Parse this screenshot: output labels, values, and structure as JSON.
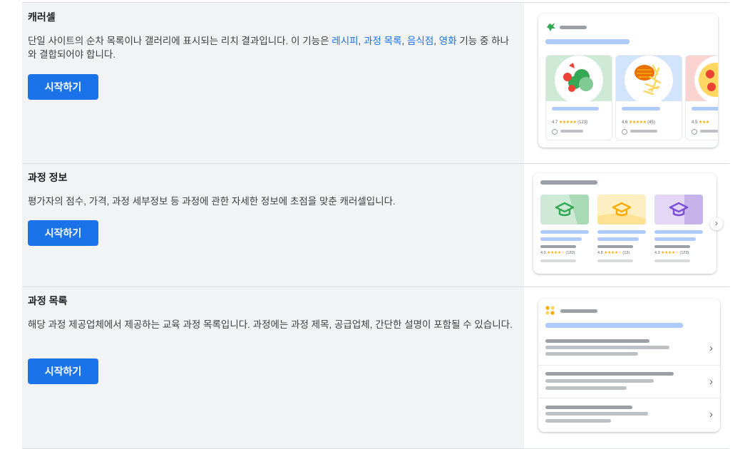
{
  "sections": [
    {
      "title": "캐러셀",
      "desc_before": "단일 사이트의 순차 목록이나 갤러리에 표시되는 리치 결과입니다. 이 기능은 ",
      "links": [
        "레시피",
        "과정 목록",
        "음식점",
        "영화"
      ],
      "sep": ", ",
      "desc_after": " 기능 중 하나와 결합되어야 합니다.",
      "button": "시작하기",
      "preview": {
        "cards": [
          {
            "rating": "4.7",
            "stars": "★★★★★",
            "count": "(123)"
          },
          {
            "rating": "4.6",
            "stars": "★★★★★",
            "count": "(45)"
          },
          {
            "rating": "4.5",
            "stars": "★★★"
          }
        ]
      }
    },
    {
      "title": "과정 정보",
      "desc": "평가자의 점수, 가격, 과정 세부정보 등 과정에 관한 자세한 정보에 초점을 맞춘 캐러셀입니다.",
      "button": "시작하기",
      "preview": {
        "cards": [
          {
            "rating": "4.0",
            "stars": "★★★★☆",
            "count": "(120)",
            "color": "#34a853",
            "bg": "#ceead6"
          },
          {
            "rating": "4.8",
            "stars": "★★★★☆",
            "count": "(13)",
            "color": "#f9ab00",
            "bg": "#feefc3"
          },
          {
            "rating": "4.3",
            "stars": "★★★★☆",
            "count": "(123)",
            "color": "#7b4fd6",
            "bg": "#e4d7f5"
          }
        ],
        "next": "›"
      }
    },
    {
      "title": "과정 목록",
      "desc": "해당 과정 제공업체에서 제공하는 교육 과정 목록입니다. 과정에는 과정 제목, 공급업체, 간단한 설명이 포함될 수 있습니다.",
      "button": "시작하기",
      "preview": {
        "chevron": "›"
      }
    }
  ],
  "colors": {
    "primary": "#1a73e8",
    "panel": "#f1f3f4",
    "divider": "#dadce0"
  }
}
